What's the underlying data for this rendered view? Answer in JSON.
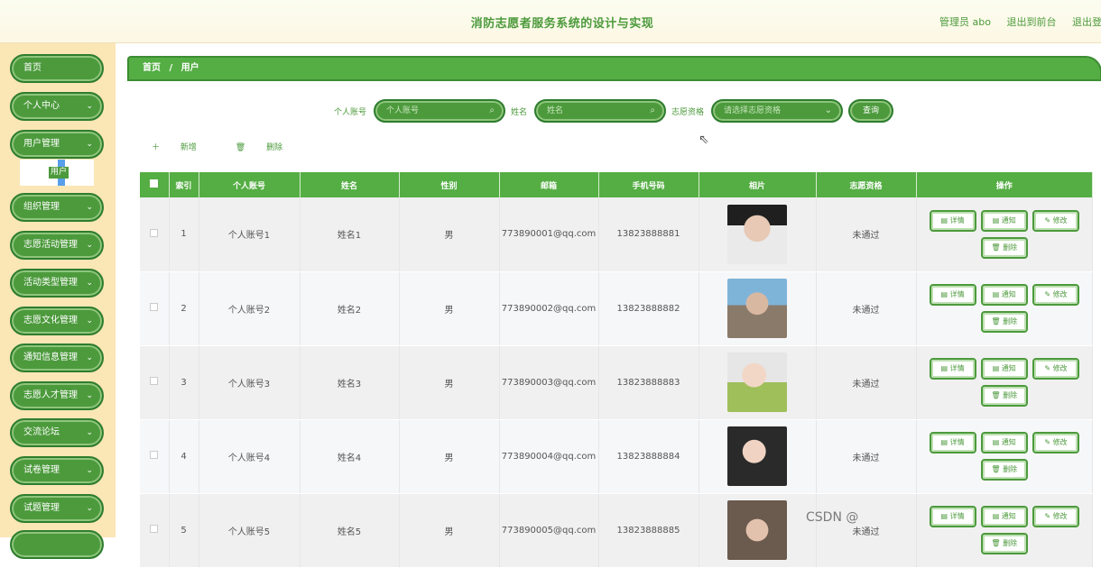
{
  "header": {
    "title": "消防志愿者服务系统的设计与实现",
    "admin": "管理员 abo",
    "back_front": "退出到前台",
    "logout": "退出登录"
  },
  "sidebar": {
    "items": [
      {
        "label": "首页",
        "chevron": false
      },
      {
        "label": "个人中心",
        "chevron": true
      },
      {
        "label": "用户管理",
        "chevron": true
      },
      {
        "label": "组织管理",
        "chevron": true
      },
      {
        "label": "志愿活动管理",
        "chevron": true
      },
      {
        "label": "活动类型管理",
        "chevron": true
      },
      {
        "label": "志愿文化管理",
        "chevron": true
      },
      {
        "label": "通知信息管理",
        "chevron": true
      },
      {
        "label": "志愿人才管理",
        "chevron": true
      },
      {
        "label": "交流论坛",
        "chevron": true
      },
      {
        "label": "试卷管理",
        "chevron": true
      },
      {
        "label": "试题管理",
        "chevron": true
      }
    ],
    "sub_item": "用户"
  },
  "breadcrumb": {
    "home": "首页",
    "sep": "/",
    "current": "用户"
  },
  "search": {
    "account_label": "个人账号",
    "account_placeholder": "个人账号",
    "name_label": "姓名",
    "name_placeholder": "姓名",
    "qual_label": "志愿资格",
    "qual_placeholder": "请选择志愿资格",
    "button": "查询"
  },
  "actions": {
    "add": "新增",
    "delete": "删除"
  },
  "table": {
    "headers": [
      "索引",
      "个人账号",
      "姓名",
      "性别",
      "邮箱",
      "手机号码",
      "相片",
      "志愿资格",
      "操作"
    ],
    "rows": [
      {
        "index": "1",
        "account": "个人账号1",
        "name": "姓名1",
        "gender": "男",
        "email": "773890001@qq.com",
        "phone": "13823888881",
        "qual": "未通过"
      },
      {
        "index": "2",
        "account": "个人账号2",
        "name": "姓名2",
        "gender": "男",
        "email": "773890002@qq.com",
        "phone": "13823888882",
        "qual": "未通过"
      },
      {
        "index": "3",
        "account": "个人账号3",
        "name": "姓名3",
        "gender": "男",
        "email": "773890003@qq.com",
        "phone": "13823888883",
        "qual": "未通过"
      },
      {
        "index": "4",
        "account": "个人账号4",
        "name": "姓名4",
        "gender": "男",
        "email": "773890004@qq.com",
        "phone": "13823888884",
        "qual": "未通过"
      },
      {
        "index": "5",
        "account": "个人账号5",
        "name": "姓名5",
        "gender": "男",
        "email": "773890005@qq.com",
        "phone": "13823888885",
        "qual": "未通过"
      }
    ],
    "op_labels": {
      "detail": "详情",
      "notify": "通知",
      "edit": "修改",
      "delete": "删除"
    }
  },
  "watermark": "CSDN @",
  "colors": {
    "primary": "#4c9a3c",
    "sidebar_bg": "#fbe6b6",
    "header_bg": "#fbfdf0"
  }
}
